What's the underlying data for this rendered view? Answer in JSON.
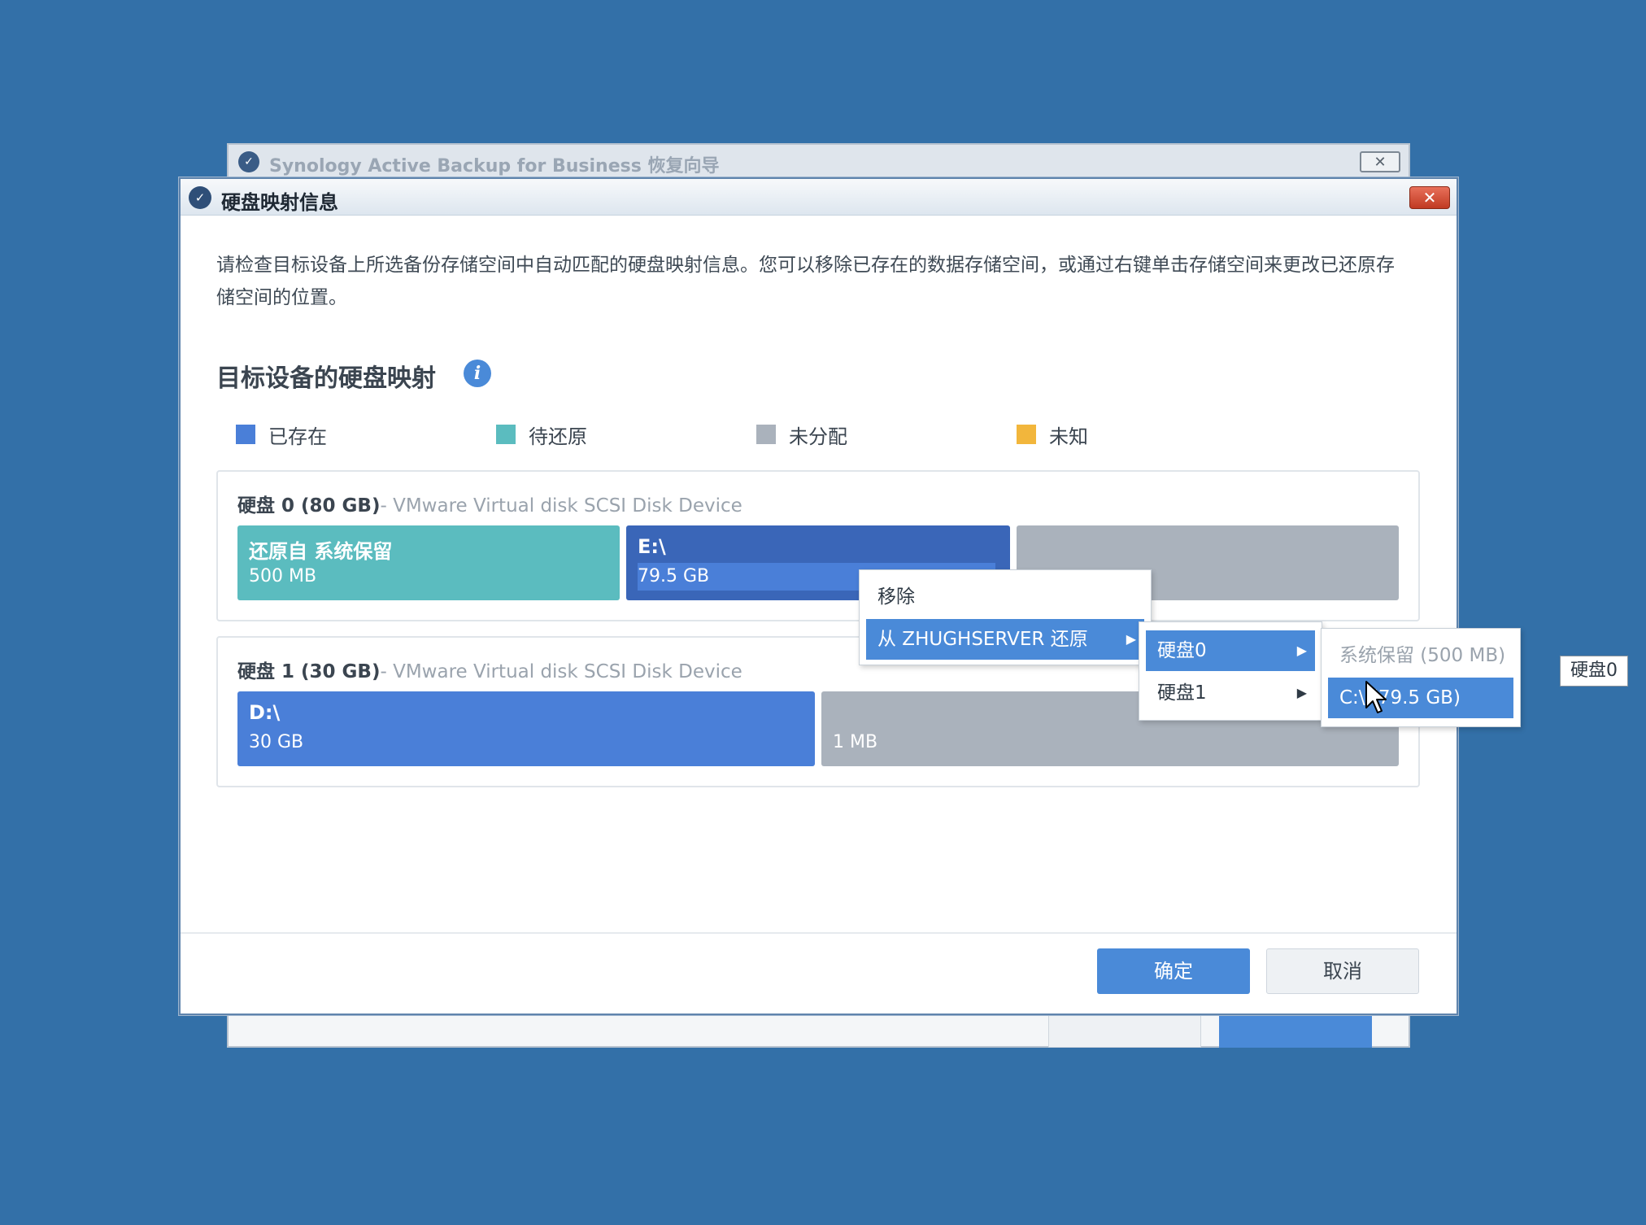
{
  "background_window": {
    "title": "Synology Active Backup for Business 恢复向导",
    "close_symbol": "✕"
  },
  "dialog": {
    "title": "硬盘映射信息",
    "close_symbol": "✕",
    "description": "请检查目标设备上所选备份存储空间中自动匹配的硬盘映射信息。您可以移除已存在的数据存储空间，或通过右键单击存储空间来更改已还原存储空间的位置。",
    "section_title": "目标设备的硬盘映射",
    "info_icon_symbol": "i",
    "legend": [
      {
        "label": "已存在",
        "color": "#4a7fd8"
      },
      {
        "label": "待还原",
        "color": "#5bbcbf"
      },
      {
        "label": "未分配",
        "color": "#aab2bc"
      },
      {
        "label": "未知",
        "color": "#f2b63c"
      }
    ],
    "disks": [
      {
        "name": "硬盘 0 (80 GB)",
        "description": "- VMware Virtual disk SCSI Disk Device",
        "partitions": [
          {
            "name": "还原自 系统保留",
            "size": "500 MB",
            "type": "pending"
          },
          {
            "name": "E:\\",
            "size": "79.5 GB",
            "type": "existing"
          },
          {
            "name": "",
            "size": "",
            "type": "unallocated"
          }
        ]
      },
      {
        "name": "硬盘 1 (30 GB)",
        "description": "- VMware Virtual disk SCSI Disk Device",
        "partitions": [
          {
            "name": "D:\\",
            "size": "30 GB",
            "type": "existing"
          },
          {
            "name": "",
            "size": "1 MB",
            "type": "unallocated"
          }
        ]
      }
    ],
    "ok_label": "确定",
    "cancel_label": "取消"
  },
  "context_menu": {
    "items": [
      "移除",
      "从 ZHUGHSERVER 还原"
    ],
    "submenu_disks": [
      "硬盘0",
      "硬盘1"
    ],
    "submenu_partitions": [
      "系统保留 (500 MB)",
      "C:\\ (79.5 GB)"
    ],
    "arrow_symbol": "▶"
  },
  "tooltip": "硬盘0",
  "colors": {
    "existing": "#4a7fd8",
    "existing_dark": "#3a66b8",
    "pending": "#5bbcbf",
    "unallocated": "#aab2bc",
    "unknown": "#f2b63c",
    "accent": "#4a8ad8",
    "desktop": "#3370a8"
  }
}
